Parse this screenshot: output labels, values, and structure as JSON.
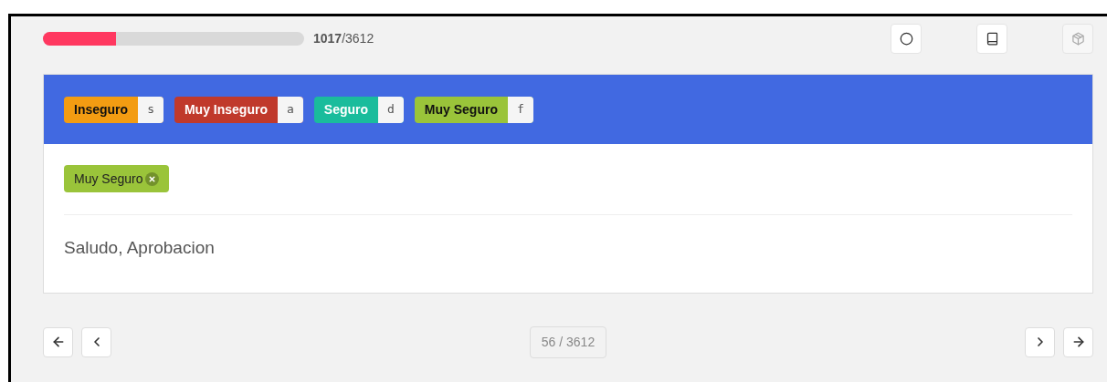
{
  "progress": {
    "level": 0.28,
    "done": "1017",
    "total": "/3612"
  },
  "toolbar": [
    {
      "kind": "circle",
      "disabled": false
    },
    {
      "kind": "book",
      "disabled": false
    },
    {
      "kind": "box",
      "disabled": true
    }
  ],
  "labels": [
    {
      "text": "Inseguro",
      "key": "s",
      "color": "#f39c12"
    },
    {
      "text": "Muy Inseguro",
      "key": "a",
      "color": "#c0392b"
    },
    {
      "text": "Seguro",
      "key": "d",
      "color": "#1abc9c"
    },
    {
      "text": "Muy Seguro",
      "key": "f",
      "color": "#9ac43a"
    }
  ],
  "selected_tags": [
    {
      "text": "Muy Seguro",
      "color": "#9ac43a"
    }
  ],
  "content": "Saludo, Aprobacion",
  "pager": {
    "counter": "56 / 3612"
  }
}
